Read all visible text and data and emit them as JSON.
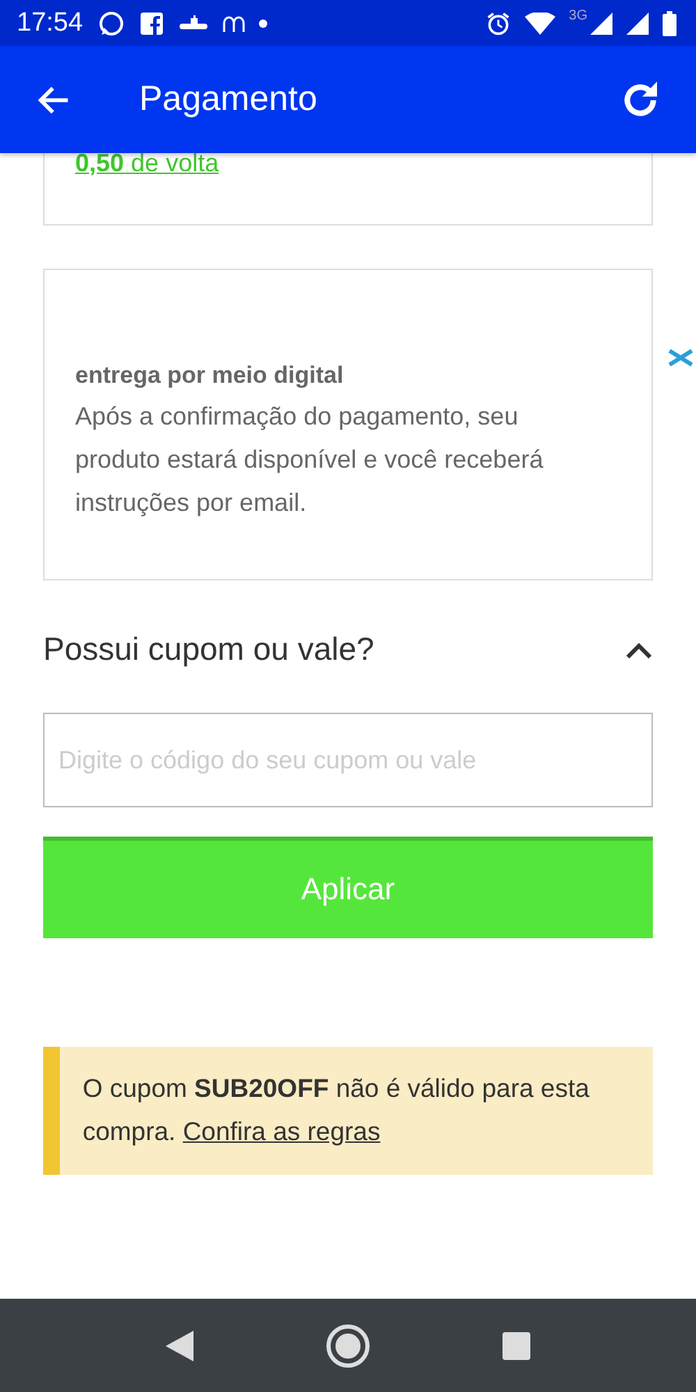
{
  "status_bar": {
    "time": "17:54",
    "network": "3G"
  },
  "app_bar": {
    "title": "Pagamento"
  },
  "change_card": {
    "text": "**0,50** de volta"
  },
  "delivery_card": {
    "title": "entrega por meio digital",
    "text": "Após a confirmação do pagamento, seu produto estará disponível e você receberá instruções por email."
  },
  "coupon": {
    "heading": "Possui cupom ou vale?",
    "expanded": true,
    "placeholder": "Digite o código do seu cupom ou vale",
    "button": "Aplicar"
  },
  "alert": {
    "message": "O cupom **SUB20OFF** não é válido para esta compra.",
    "link": "Confira as regras"
  }
}
